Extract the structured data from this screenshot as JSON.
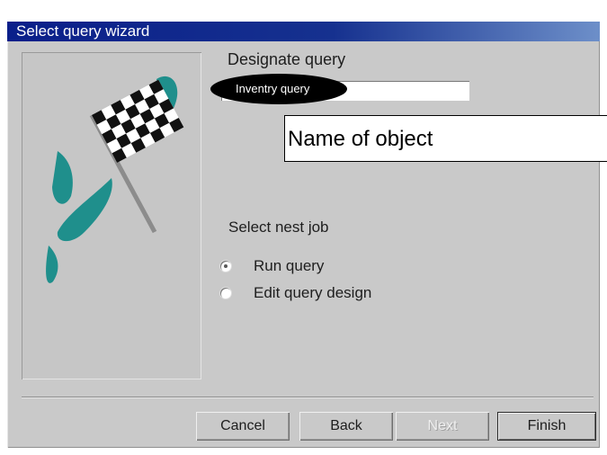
{
  "window": {
    "title": "Select query wizard"
  },
  "step": {
    "designate_label": "Designate query",
    "query_value": "Inventry query",
    "callout_text": "Name of object",
    "next_job_label": "Select nest job",
    "options": [
      {
        "label": "Run query",
        "selected": true
      },
      {
        "label": "Edit query design",
        "selected": false
      }
    ]
  },
  "buttons": {
    "cancel": "Cancel",
    "back": "Back",
    "next": "Next",
    "finish": "Finish"
  },
  "colors": {
    "title_bar_start": "#0a1f8a",
    "title_bar_end": "#6d8fc9",
    "flag_accent": "#1f8f8c"
  },
  "icons": {
    "wizard_image": "checkered-flag-icon"
  }
}
